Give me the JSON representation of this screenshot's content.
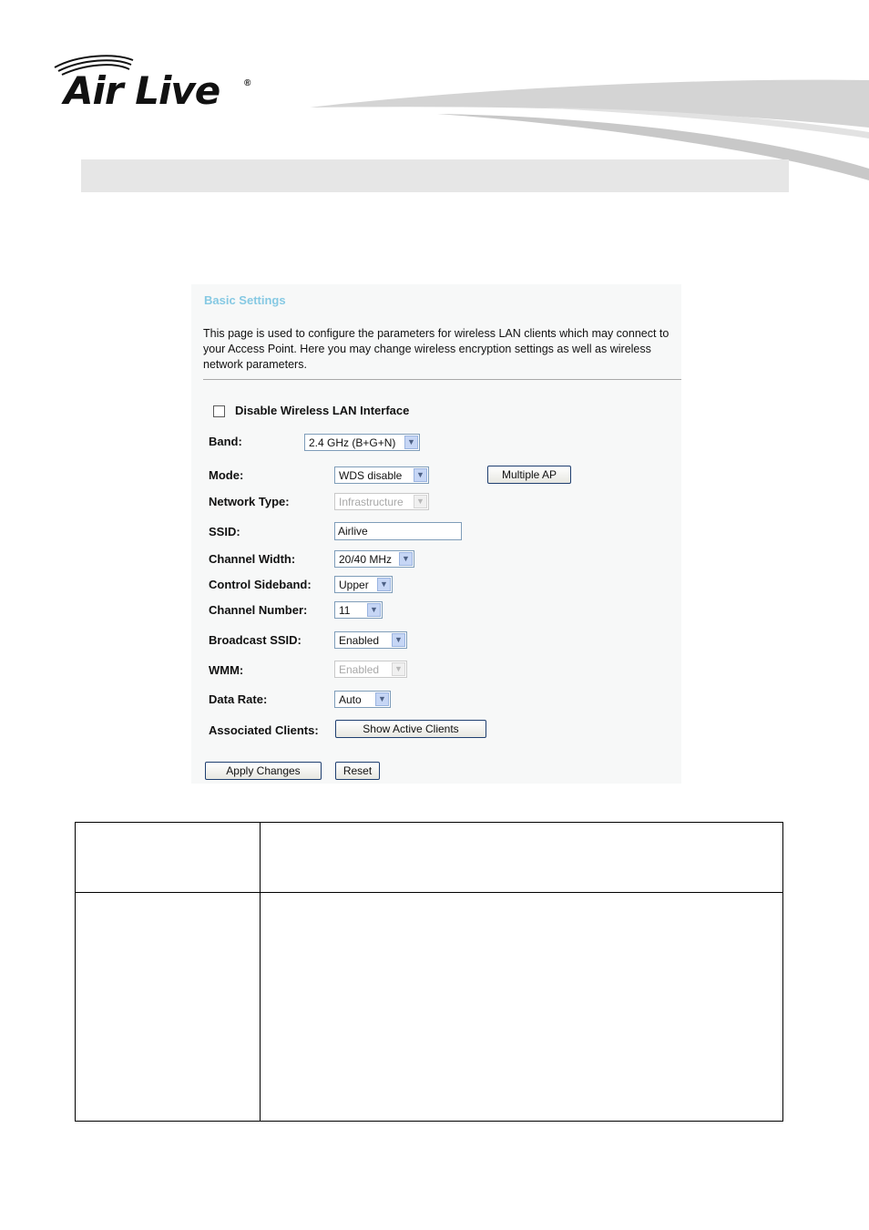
{
  "logo": {
    "text": "Air Live",
    "reg_mark": "®"
  },
  "panel": {
    "title": "Basic Settings",
    "description": "This page is used to configure the parameters for wireless LAN clients which may connect to your Access Point. Here you may change wireless encryption settings as well as wireless network parameters.",
    "disable_wlan_label": "Disable Wireless LAN Interface",
    "disable_wlan_checked": false,
    "fields": {
      "band": {
        "label": "Band:",
        "value": "2.4 GHz (B+G+N)"
      },
      "mode": {
        "label": "Mode:",
        "value": "WDS disable"
      },
      "network_type": {
        "label": "Network Type:",
        "value": "Infrastructure"
      },
      "ssid": {
        "label": "SSID:",
        "value": "Airlive"
      },
      "channel_width": {
        "label": "Channel Width:",
        "value": "20/40 MHz"
      },
      "control_sideband": {
        "label": "Control Sideband:",
        "value": "Upper"
      },
      "channel_number": {
        "label": "Channel Number:",
        "value": "11"
      },
      "broadcast_ssid": {
        "label": "Broadcast SSID:",
        "value": "Enabled"
      },
      "wmm": {
        "label": "WMM:",
        "value": "Enabled"
      },
      "data_rate": {
        "label": "Data Rate:",
        "value": "Auto"
      },
      "associated_clients": {
        "label": "Associated Clients:"
      }
    },
    "buttons": {
      "multiple_ap": "Multiple AP",
      "show_active_clients": "Show Active Clients",
      "apply_changes": "Apply Changes",
      "reset": "Reset"
    }
  },
  "colors": {
    "panel_title": "#86c9e3",
    "header_bar": "#e6e6e6",
    "select_arrow": "#c6d6f5"
  },
  "icons": {
    "dropdown_arrow": "chevron-down-icon",
    "checkbox": "checkbox-icon"
  }
}
